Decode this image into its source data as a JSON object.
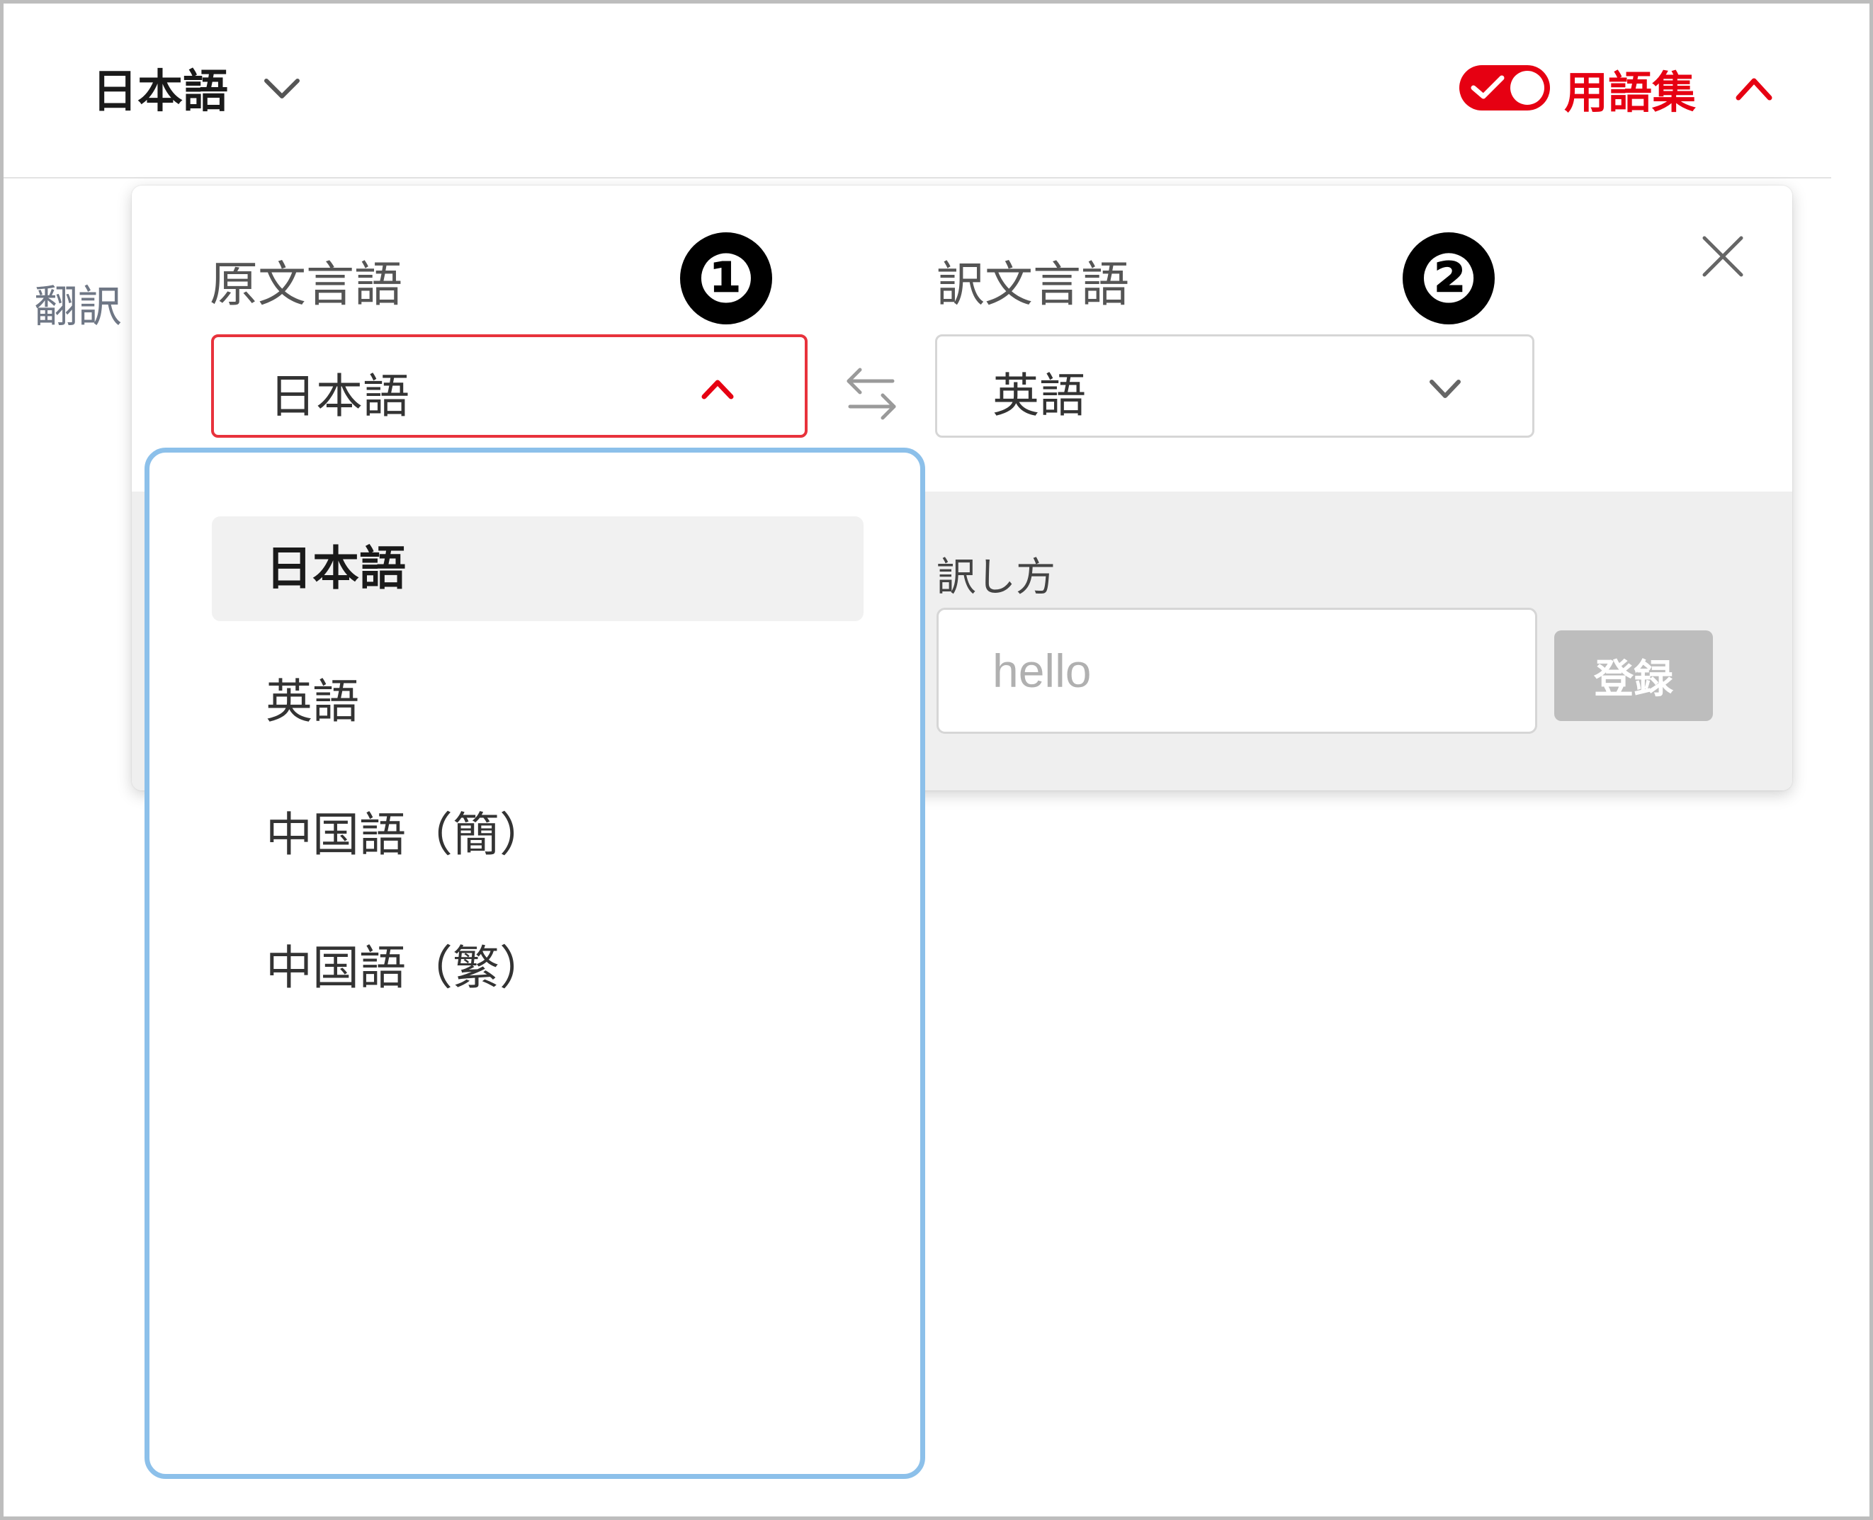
{
  "header": {
    "language_selector": "日本語",
    "glossary_toggle_on": true,
    "glossary_label": "用語集"
  },
  "background": {
    "partial_text": "翻訳"
  },
  "glossary_panel": {
    "source_language": {
      "label": "原文言語",
      "value": "日本語",
      "badge": "❶"
    },
    "target_language": {
      "label": "訳文言語",
      "value": "英語",
      "badge": "❷"
    },
    "translation_method": {
      "label": "訳し方",
      "placeholder": "hello",
      "register_button": "登録"
    }
  },
  "source_dropdown": {
    "items": [
      {
        "label": "日本語",
        "selected": true
      },
      {
        "label": "英語",
        "selected": false
      },
      {
        "label": "中国語（簡）",
        "selected": false
      },
      {
        "label": "中国語（繁）",
        "selected": false
      }
    ]
  },
  "colors": {
    "accent_red": "#e60012",
    "dropdown_border": "#8cc0ea",
    "disabled_button": "#bdbdbd"
  }
}
